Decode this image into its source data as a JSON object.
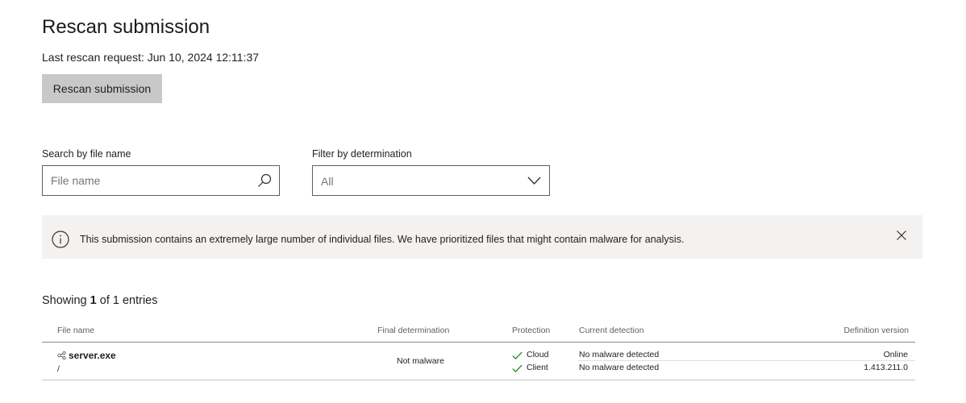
{
  "page": {
    "title": "Rescan submission",
    "last_rescan": "Last rescan request: Jun 10, 2024 12:11:37",
    "rescan_button": "Rescan submission"
  },
  "search": {
    "label": "Search by file name",
    "placeholder": "File name",
    "value": "",
    "icon": "search-icon"
  },
  "filter": {
    "label": "Filter by determination",
    "selected": "All",
    "icon": "chevron-down-icon"
  },
  "banner": {
    "icon": "info-icon",
    "text": "This submission contains an extremely large number of individual files. We have prioritized files that might contain malware for analysis.",
    "close_icon": "close-icon"
  },
  "results": {
    "showing_prefix": "Showing ",
    "showing_count": "1",
    "showing_suffix": " of 1 entries"
  },
  "table": {
    "columns": {
      "file_name": "File name",
      "final_determination": "Final determination",
      "protection": "Protection",
      "current_detection": "Current detection",
      "definition_version": "Definition version"
    },
    "rows": [
      {
        "file_name": "server.exe",
        "file_path": "/",
        "final_determination": "Not malware",
        "protection": [
          {
            "label": "Cloud",
            "detection": "No malware detected",
            "definition": "Online"
          },
          {
            "label": "Client",
            "detection": "No malware detected",
            "definition": "1.413.211.0"
          }
        ]
      }
    ]
  },
  "colors": {
    "button_bg": "#c8c8c8",
    "banner_bg": "#f3f2f1",
    "check_green": "#107c10",
    "border": "#605e5c"
  }
}
